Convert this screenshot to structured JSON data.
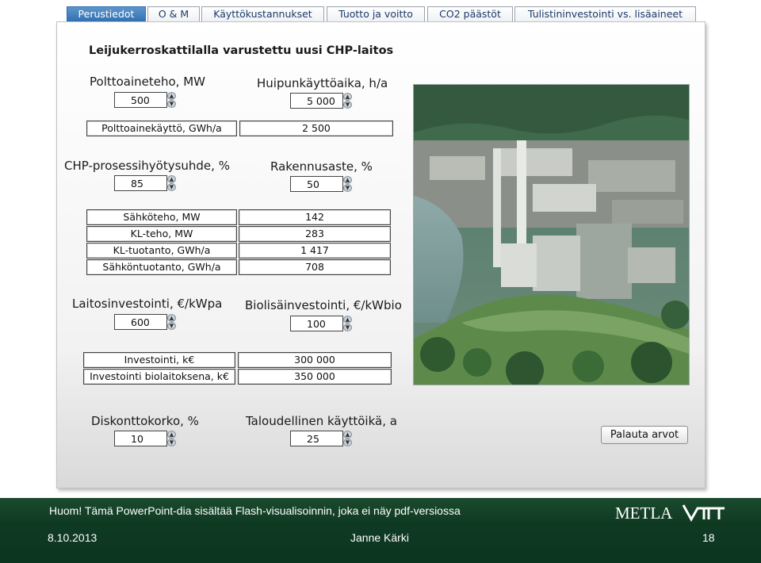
{
  "tabs": [
    {
      "label": "Perustiedot",
      "active": true
    },
    {
      "label": "O & M",
      "active": false
    },
    {
      "label": "Käyttökustannukset",
      "active": false
    },
    {
      "label": "Tuotto ja voitto",
      "active": false
    },
    {
      "label": "CO2 päästöt",
      "active": false
    },
    {
      "label": "Tulistininvestointi vs. lisäaineet",
      "active": false
    }
  ],
  "title": "Leijukerroskattilalla varustettu uusi CHP-laitos",
  "inputs": {
    "polttoaineteho": {
      "label": "Polttoaineteho, MW",
      "value": "500"
    },
    "huipunkayttoaika": {
      "label": "Huipunkäyttöaika, h/a",
      "value": "5 000"
    },
    "hyotysuhde": {
      "label": "CHP-prosessihyötysuhde, %",
      "value": "85"
    },
    "rakennusaste": {
      "label": "Rakennusaste, %",
      "value": "50"
    },
    "laitosinvestointi": {
      "label": "Laitosinvestointi, €/kWpa",
      "value": "600"
    },
    "biolisainvestointi": {
      "label": "Biolisäinvestointi, €/kWbio",
      "value": "100"
    },
    "diskonttokorko": {
      "label": "Diskonttokorko, %",
      "value": "10"
    },
    "kayttoika": {
      "label": "Taloudellinen käyttöikä, a",
      "value": "25"
    }
  },
  "outputs": {
    "polttoainekaytto": {
      "label": "Polttoainekäyttö, GWh/a",
      "value": "2 500"
    },
    "energy": [
      {
        "label": "Sähköteho, MW",
        "value": "142"
      },
      {
        "label": "KL-teho, MW",
        "value": "283"
      },
      {
        "label": "KL-tuotanto, GWh/a",
        "value": "1 417"
      },
      {
        "label": "Sähköntuotanto, GWh/a",
        "value": "708"
      }
    ],
    "investment": [
      {
        "label": "Investointi, k€",
        "value": "300 000"
      },
      {
        "label": "Investointi biolaitoksena, k€",
        "value": "350 000"
      }
    ]
  },
  "reset_label": "Palauta arvot",
  "footer": {
    "notice": "Huom! Tämä PowerPoint-dia sisältää Flash-visualisoinnin, joka ei näy pdf-versiossa",
    "date": "8.10.2013",
    "author": "Janne Kärki",
    "page": "18",
    "logo_text": "METLA"
  },
  "colors": {
    "tab_active": "#2f6fb0",
    "footer_bg": "#0f3a22",
    "text_dark": "#1a1a1a"
  },
  "icons": {
    "spin_up": "up-arrow-icon",
    "spin_down": "down-arrow-icon"
  }
}
